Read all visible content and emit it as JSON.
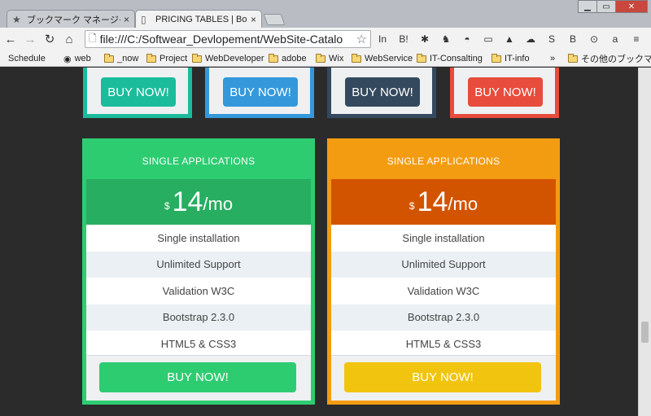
{
  "browser": {
    "tabs": [
      {
        "icon": "★",
        "title": "ブックマーク マネージャ"
      },
      {
        "icon": "▯",
        "title": "PRICING TABLES | Boot"
      }
    ],
    "window_controls": {
      "minimize": "▁",
      "maximize": "▭",
      "close": "✕"
    },
    "nav": {
      "back": "←",
      "forward": "→",
      "reload": "↻",
      "home": "⌂"
    },
    "address": {
      "scheme_icon": "🗋",
      "url": "file:///C:/Softwear_Devlopement/WebSite-Catalo",
      "star": "☆"
    },
    "extensions": [
      "In",
      "B!",
      "✱",
      "♞",
      "◓",
      "▭",
      "▲",
      "☁",
      "S",
      "B",
      "⊙",
      "a",
      "≡"
    ],
    "bookmarks": [
      {
        "icon": "apple-icon",
        "glyph": "",
        "label": "Schedule"
      },
      {
        "icon": "chrome-icon",
        "glyph": "◉",
        "label": "web"
      },
      {
        "icon": "folder-icon",
        "label": "_now"
      },
      {
        "icon": "folder-icon",
        "label": "Project"
      },
      {
        "icon": "folder-icon",
        "label": "WebDeveloper"
      },
      {
        "icon": "folder-icon",
        "label": "adobe"
      },
      {
        "icon": "folder-icon",
        "label": "Wix"
      },
      {
        "icon": "folder-icon",
        "label": "WebService"
      },
      {
        "icon": "folder-icon",
        "label": "IT-Consalting"
      },
      {
        "icon": "folder-icon",
        "label": "IT-info"
      },
      {
        "icon": "overflow-icon",
        "glyph": "»",
        "label": ""
      },
      {
        "icon": "folder-icon",
        "label": "その他のブックマーク"
      }
    ]
  },
  "top_cards": [
    {
      "button": "BUY NOW!",
      "border": "#1abc9c",
      "btn_color": "#1abc9c"
    },
    {
      "button": "BUY NOW!",
      "border": "#3498db",
      "btn_color": "#3498db"
    },
    {
      "button": "BUY NOW!",
      "border": "#34495e",
      "btn_color": "#34495e"
    },
    {
      "button": "BUY NOW!",
      "border": "#e74c3c",
      "btn_color": "#e74c3c"
    }
  ],
  "pricing_cards": [
    {
      "title": "SINGLE APPLICATIONS",
      "currency": "$",
      "amount": "14",
      "period": "/mo",
      "features": [
        "Single installation",
        "Unlimited Support",
        "Validation W3C",
        "Bootstrap 2.3.0",
        "HTML5 & CSS3"
      ],
      "button": "BUY NOW!",
      "colors": {
        "border": "#2ecc71",
        "head": "#2ecc71",
        "price": "#27ae60",
        "button": "#2ecc71"
      }
    },
    {
      "title": "SINGLE APPLICATIONS",
      "currency": "$",
      "amount": "14",
      "period": "/mo",
      "features": [
        "Single installation",
        "Unlimited Support",
        "Validation W3C",
        "Bootstrap 2.3.0",
        "HTML5 & CSS3"
      ],
      "button": "BUY NOW!",
      "colors": {
        "border": "#f39c12",
        "head": "#f39c12",
        "price": "#d35400",
        "button": "#f1c40f"
      }
    }
  ]
}
